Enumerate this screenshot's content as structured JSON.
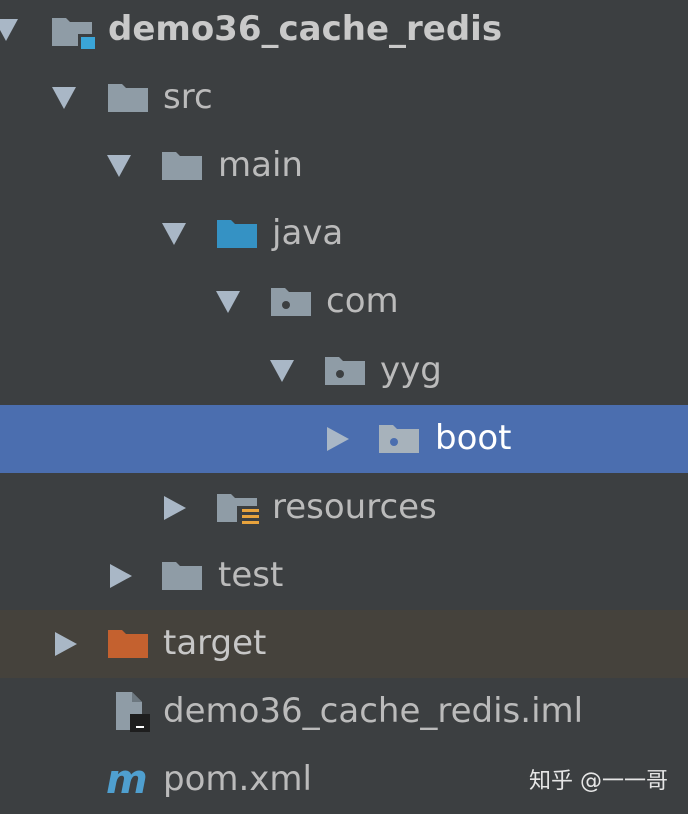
{
  "project_tree": {
    "root": {
      "label": "demo36_cache_redis",
      "icon": "module-folder-icon",
      "expanded": true
    },
    "src": {
      "label": "src",
      "icon": "folder-icon",
      "expanded": true
    },
    "main": {
      "label": "main",
      "icon": "folder-icon",
      "expanded": true
    },
    "java": {
      "label": "java",
      "icon": "source-root-folder-icon",
      "expanded": true
    },
    "com": {
      "label": "com",
      "icon": "package-icon",
      "expanded": true
    },
    "yyg": {
      "label": "yyg",
      "icon": "package-icon",
      "expanded": true
    },
    "boot": {
      "label": "boot",
      "icon": "package-icon",
      "expanded": false,
      "selected": true
    },
    "resources": {
      "label": "resources",
      "icon": "resources-folder-icon",
      "expanded": false
    },
    "test": {
      "label": "test",
      "icon": "folder-icon",
      "expanded": false
    },
    "target": {
      "label": "target",
      "icon": "excluded-folder-icon",
      "expanded": false
    },
    "iml_file": {
      "label": "demo36_cache_redis.iml",
      "icon": "iml-file-icon"
    },
    "pom_file": {
      "label": "pom.xml",
      "icon": "maven-icon"
    }
  },
  "watermark": {
    "text": "知乎 @一一哥"
  },
  "colors": {
    "background": "#3c3f41",
    "selection": "#4b6eaf",
    "excluded_row": "#45423c",
    "folder": "#8f9ca6",
    "source_root": "#3592c4",
    "excluded_folder": "#c4612f",
    "resources_marker": "#e8a33d",
    "maven": "#4f9fcf"
  }
}
